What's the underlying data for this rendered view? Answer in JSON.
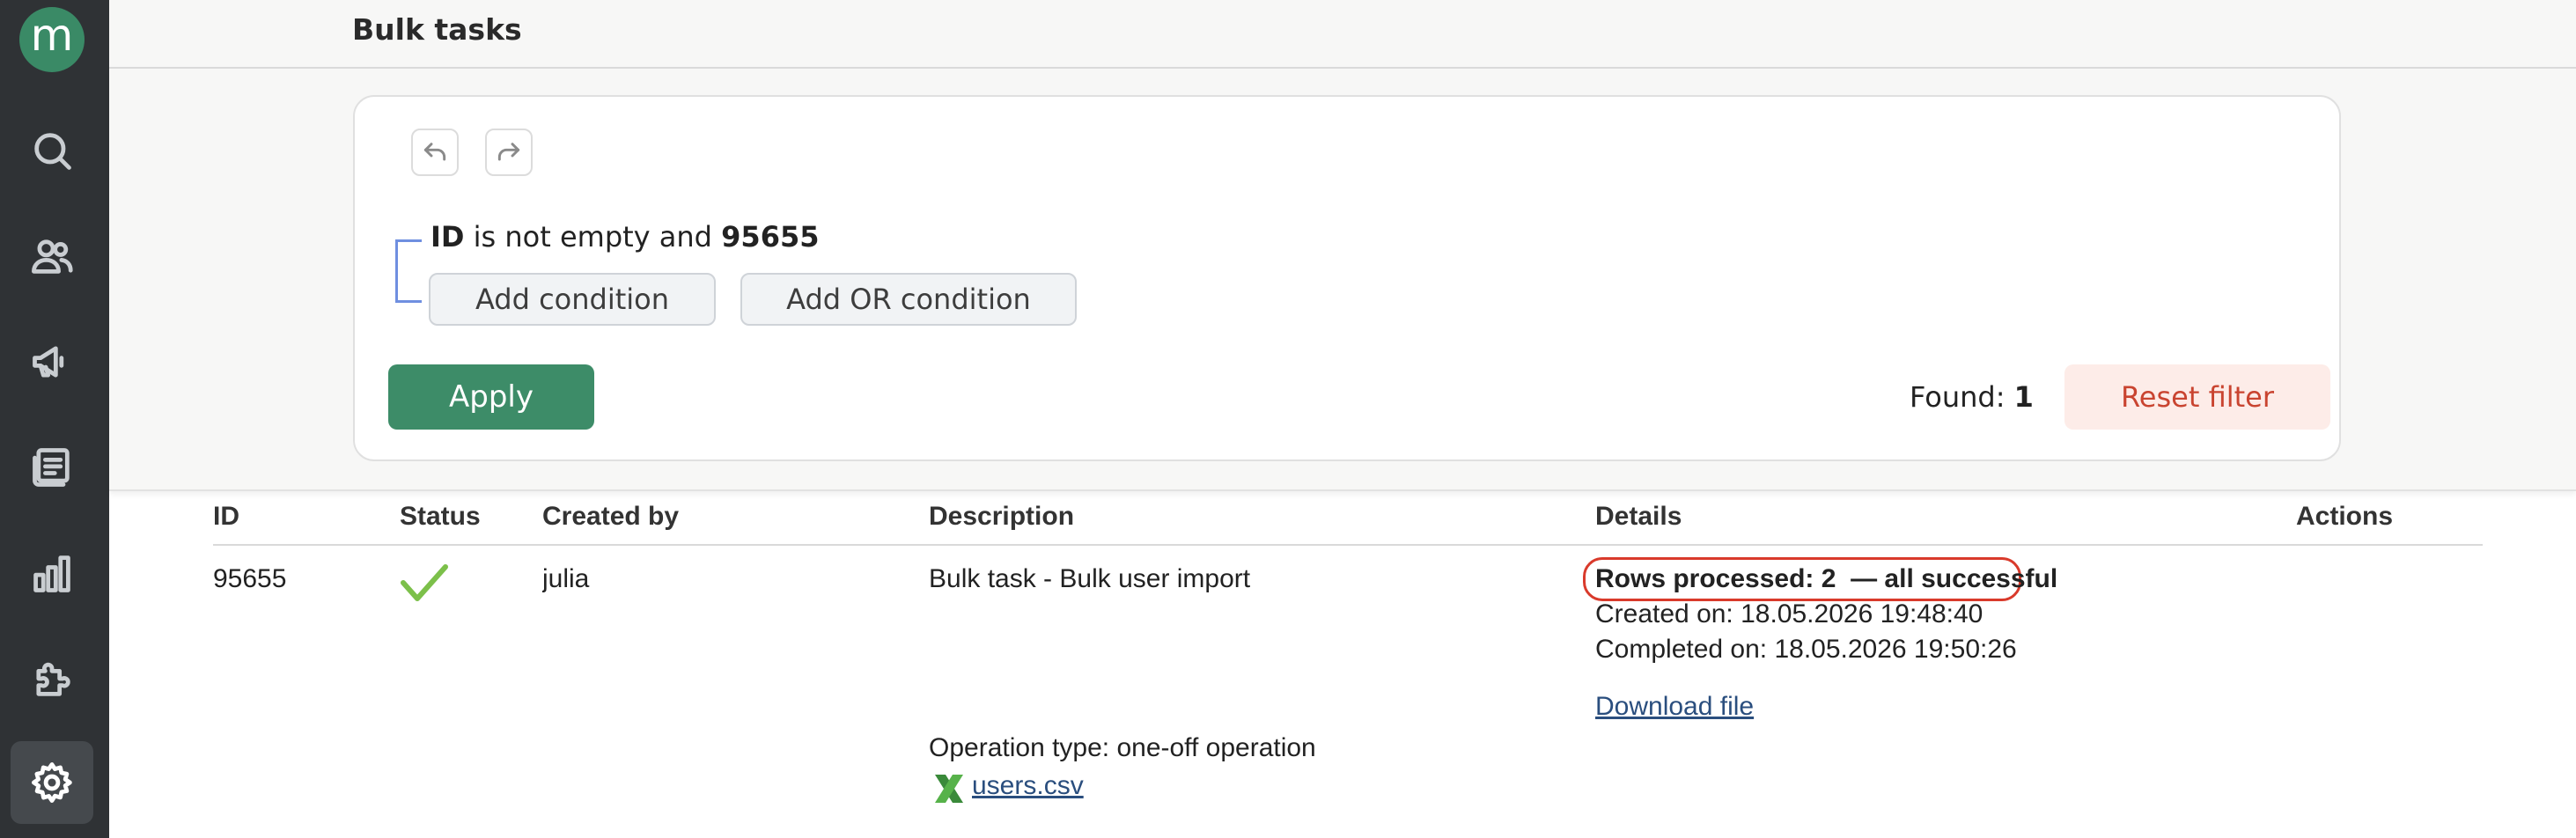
{
  "app": {
    "logo_letter": "m"
  },
  "sidebar": {
    "items": [
      {
        "icon": "search-icon"
      },
      {
        "icon": "users-icon"
      },
      {
        "icon": "megaphone-icon"
      },
      {
        "icon": "newsletter-icon"
      },
      {
        "icon": "analytics-icon"
      },
      {
        "icon": "puzzle-icon"
      },
      {
        "icon": "settings-icon",
        "active": true
      }
    ]
  },
  "header": {
    "title": "Bulk tasks"
  },
  "filter": {
    "condition": {
      "field": "ID",
      "operator": " is not empty and ",
      "value": "95655"
    },
    "add_condition_label": "Add condition",
    "add_or_condition_label": "Add OR condition",
    "apply_label": "Apply",
    "found_label": "Found: ",
    "found_count": "1",
    "reset_label": "Reset filter"
  },
  "table": {
    "columns": [
      "ID",
      "Status",
      "Created by",
      "Description",
      "Details",
      "Actions"
    ],
    "rows": [
      {
        "id": "95655",
        "status": "success",
        "created_by": "julia",
        "description": "Bulk task - Bulk user import",
        "operation_type": "Operation type: one-off operation",
        "file_name": "users.csv",
        "details": {
          "rows_processed": "Rows processed: 2  — all successful",
          "created_on": "Created on: 18.05.2026 19:48:40",
          "completed_on": "Completed on: 18.05.2026 19:50:26",
          "download_label": "Download file"
        }
      }
    ]
  },
  "colors": {
    "sidebar_bg": "#2f3235",
    "accent_green": "#3d8c68",
    "reset_text": "#c94430",
    "highlight_border": "#d93a2b"
  }
}
